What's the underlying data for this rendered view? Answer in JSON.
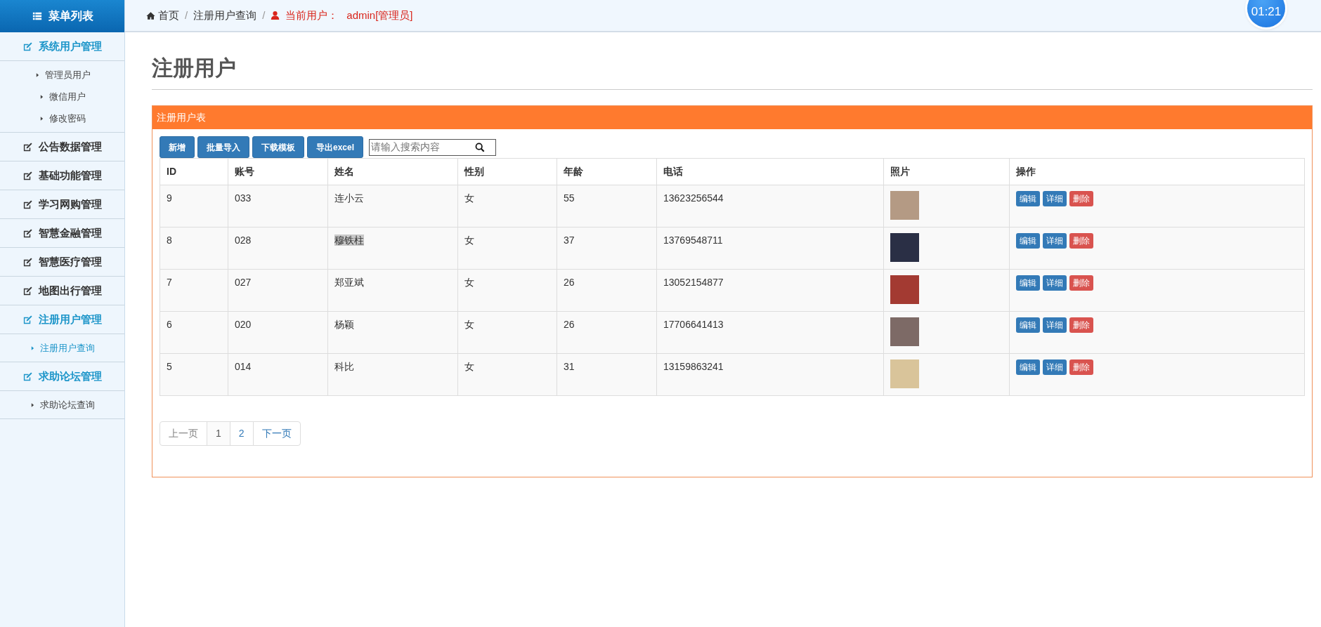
{
  "sidebar": {
    "title": "菜单列表",
    "groups": [
      {
        "label": "系统用户管理",
        "selected": true,
        "children": [
          {
            "label": "管理员用户",
            "selected": false
          },
          {
            "label": "微信用户",
            "selected": false
          },
          {
            "label": "修改密码",
            "selected": false
          }
        ]
      },
      {
        "label": "公告数据管理",
        "selected": false
      },
      {
        "label": "基础功能管理",
        "selected": false
      },
      {
        "label": "学习网购管理",
        "selected": false
      },
      {
        "label": "智慧金融管理",
        "selected": false
      },
      {
        "label": "智慧医疗管理",
        "selected": false
      },
      {
        "label": "地图出行管理",
        "selected": false
      },
      {
        "label": "注册用户管理",
        "selected": true,
        "children": [
          {
            "label": "注册用户查询",
            "selected": true
          }
        ]
      },
      {
        "label": "求助论坛管理",
        "selected": true,
        "children": [
          {
            "label": "求助论坛查询",
            "selected": false
          }
        ]
      }
    ]
  },
  "breadcrumb": {
    "items": [
      "首页",
      "注册用户查询"
    ],
    "separators": [
      "/",
      "/"
    ],
    "user_label": "当前用户：",
    "user": "admin[管理员]"
  },
  "timer": "01:21",
  "page_title": "注册用户",
  "panel": {
    "title": "注册用户表",
    "toolbar": [
      {
        "label": "新增"
      },
      {
        "label": "批量导入"
      },
      {
        "label": "下载模板"
      },
      {
        "label": "导出excel"
      }
    ],
    "search": {
      "placeholder": "请输入搜索内容"
    },
    "table": {
      "columns": [
        "ID",
        "账号",
        "姓名",
        "性别",
        "年龄",
        "电话",
        "照片",
        "操作"
      ],
      "rows": [
        {
          "id": "9",
          "account": "033",
          "name": "连小云",
          "name_highlighted": false,
          "gender": "女",
          "age": "55",
          "phone": "13623256544",
          "actions": [
            {
              "label": "编辑",
              "kind": "primary"
            },
            {
              "label": "详细",
              "kind": "primary"
            },
            {
              "label": "删除",
              "kind": "danger"
            }
          ]
        },
        {
          "id": "8",
          "account": "028",
          "name": "穆铁柱",
          "name_highlighted": true,
          "gender": "女",
          "age": "37",
          "phone": "13769548711",
          "actions": [
            {
              "label": "编辑",
              "kind": "primary"
            },
            {
              "label": "详细",
              "kind": "primary"
            },
            {
              "label": "删除",
              "kind": "danger"
            }
          ]
        },
        {
          "id": "7",
          "account": "027",
          "name": "郑亚斌",
          "name_highlighted": false,
          "gender": "女",
          "age": "26",
          "phone": "13052154877",
          "actions": [
            {
              "label": "编辑",
              "kind": "primary"
            },
            {
              "label": "详细",
              "kind": "primary"
            },
            {
              "label": "删除",
              "kind": "danger"
            }
          ]
        },
        {
          "id": "6",
          "account": "020",
          "name": "杨颖",
          "name_highlighted": false,
          "gender": "女",
          "age": "26",
          "phone": "17706641413",
          "actions": [
            {
              "label": "编辑",
              "kind": "primary"
            },
            {
              "label": "详细",
              "kind": "primary"
            },
            {
              "label": "删除",
              "kind": "danger"
            }
          ]
        },
        {
          "id": "5",
          "account": "014",
          "name": "科比",
          "name_highlighted": false,
          "gender": "女",
          "age": "31",
          "phone": "13159863241",
          "actions": [
            {
              "label": "编辑",
              "kind": "primary"
            },
            {
              "label": "详细",
              "kind": "primary"
            },
            {
              "label": "删除",
              "kind": "danger"
            }
          ]
        }
      ]
    },
    "pagination": [
      {
        "label": "上一页",
        "disabled": true,
        "selected": false
      },
      {
        "label": "1",
        "disabled": false,
        "selected": true
      },
      {
        "label": "2",
        "disabled": false,
        "selected": false
      },
      {
        "label": "下一页",
        "disabled": false,
        "selected": false
      }
    ]
  }
}
